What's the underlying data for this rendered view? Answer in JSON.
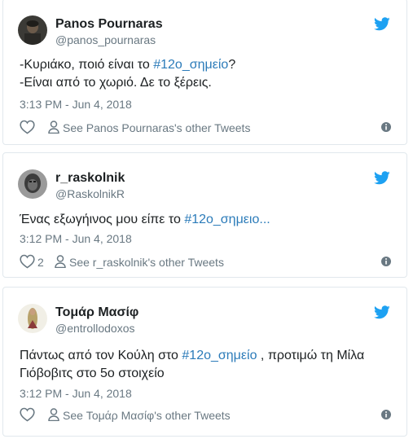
{
  "tweets": [
    {
      "name": "Panos Pournaras",
      "handle": "@panos_pournaras",
      "text_lines": [
        [
          {
            "t": "-Κυριάκο, ποιό είναι το "
          },
          {
            "t": "#12ο_σημείο",
            "h": true
          },
          {
            "t": "?"
          }
        ],
        [
          {
            "t": "-Είναι από το χωριό. Δε το ξέρεις."
          }
        ]
      ],
      "time": "3:13 PM - Jun 4, 2018",
      "likes": "",
      "other_tweets": "See Panos Pournaras's other Tweets",
      "avatar": "dark-portrait"
    },
    {
      "name": "r_raskolnik",
      "handle": "@RaskolnikR",
      "text_lines": [
        [
          {
            "t": "Ένας εξωγήινος μου είπε το "
          },
          {
            "t": "#12ο_σημειο...",
            "h": true
          }
        ]
      ],
      "time": "3:12 PM - Jun 4, 2018",
      "likes": "2",
      "other_tweets": "See r_raskolnik's other Tweets",
      "avatar": "grayscale-portrait"
    },
    {
      "name": "Τομάρ Μασίφ",
      "handle": "@entrollodoxos",
      "text_lines": [
        [
          {
            "t": "Πάντως από τον Κούλη στο "
          },
          {
            "t": "#12ο_σημείο",
            "h": true
          },
          {
            "t": " , προτιμώ τη Μίλα"
          }
        ],
        [
          {
            "t": "Γιόβοβιτς στο 5ο στοιχείο"
          }
        ]
      ],
      "time": "3:12 PM - Jun 4, 2018",
      "likes": "",
      "other_tweets": "See Τομάρ Μασίφ's other Tweets",
      "avatar": "icon-portrait"
    }
  ],
  "icons": {
    "bird": "twitter-bird-icon",
    "heart": "heart-icon",
    "person": "person-icon",
    "info": "info-icon"
  },
  "colors": {
    "twitter_blue": "#1da1f2",
    "hashtag": "#2b7bb9",
    "secondary_text": "#697882",
    "primary_text": "#1c2022",
    "border": "#e1e8ed"
  }
}
